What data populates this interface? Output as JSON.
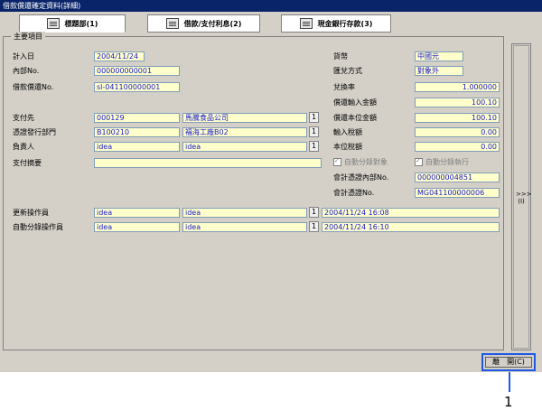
{
  "window": {
    "title": "借款償還確定資料(詳細)"
  },
  "tabs": [
    {
      "label": "標題部(1)",
      "icon": "book-icon"
    },
    {
      "label": "借款/支付利息(2)",
      "icon": "document-icon"
    },
    {
      "label": "現金銀行存款(3)",
      "icon": "bank-icon"
    }
  ],
  "section": {
    "title": "主要項目"
  },
  "left": {
    "entry_date": {
      "label": "計入日",
      "value": "2004/11/24"
    },
    "internal_no": {
      "label": "內部No.",
      "value": "000000000001"
    },
    "loan_repay_no": {
      "label": "借款償還No.",
      "value": "sl-041100000001"
    },
    "payee": {
      "label": "支付先",
      "code": "000129",
      "name": "馬騰食品公司"
    },
    "voucher_dept": {
      "label": "憑證發行部門",
      "code": "B100210",
      "name": "福海工廠B02"
    },
    "person": {
      "label": "負責人",
      "code": "idea",
      "name": "idea"
    },
    "summary": {
      "label": "支付摘要",
      "value": ""
    },
    "updater": {
      "label": "更新操作員",
      "code": "idea",
      "name": "idea",
      "time": "2004/11/24 16:08"
    },
    "auto_entry_operator": {
      "label": "自動分錄操作員",
      "code": "idea",
      "name": "idea",
      "time": "2004/11/24 16:10"
    },
    "select_btn": "1"
  },
  "right": {
    "currency": {
      "label": "貨幣",
      "value": "中國元"
    },
    "rate_method": {
      "label": "匯兌方式",
      "value": "對象外"
    },
    "exchange_rate": {
      "label": "兌換率",
      "value": "1.000000"
    },
    "repay_input_amount": {
      "label": "償還輸入金額",
      "value": "100.10"
    },
    "repay_base_amount": {
      "label": "償還本位金額",
      "value": "100.10"
    },
    "input_tax": {
      "label": "輸入稅額",
      "value": "0.00"
    },
    "base_tax": {
      "label": "本位稅額",
      "value": "0.00"
    },
    "auto_entry_target": {
      "label": "自動分錄對象"
    },
    "auto_entry_exec": {
      "label": "自動分錄執行"
    },
    "acct_voucher_internal_no": {
      "label": "會計憑證內部No.",
      "value": "000000004851"
    },
    "acct_voucher_no": {
      "label": "會計憑證No.",
      "value": "MG041100000006"
    }
  },
  "side_button": {
    "arrows": ">>>",
    "label": "(I)"
  },
  "footer": {
    "close_label": "離　開(C)"
  },
  "callout": {
    "number": "1"
  }
}
